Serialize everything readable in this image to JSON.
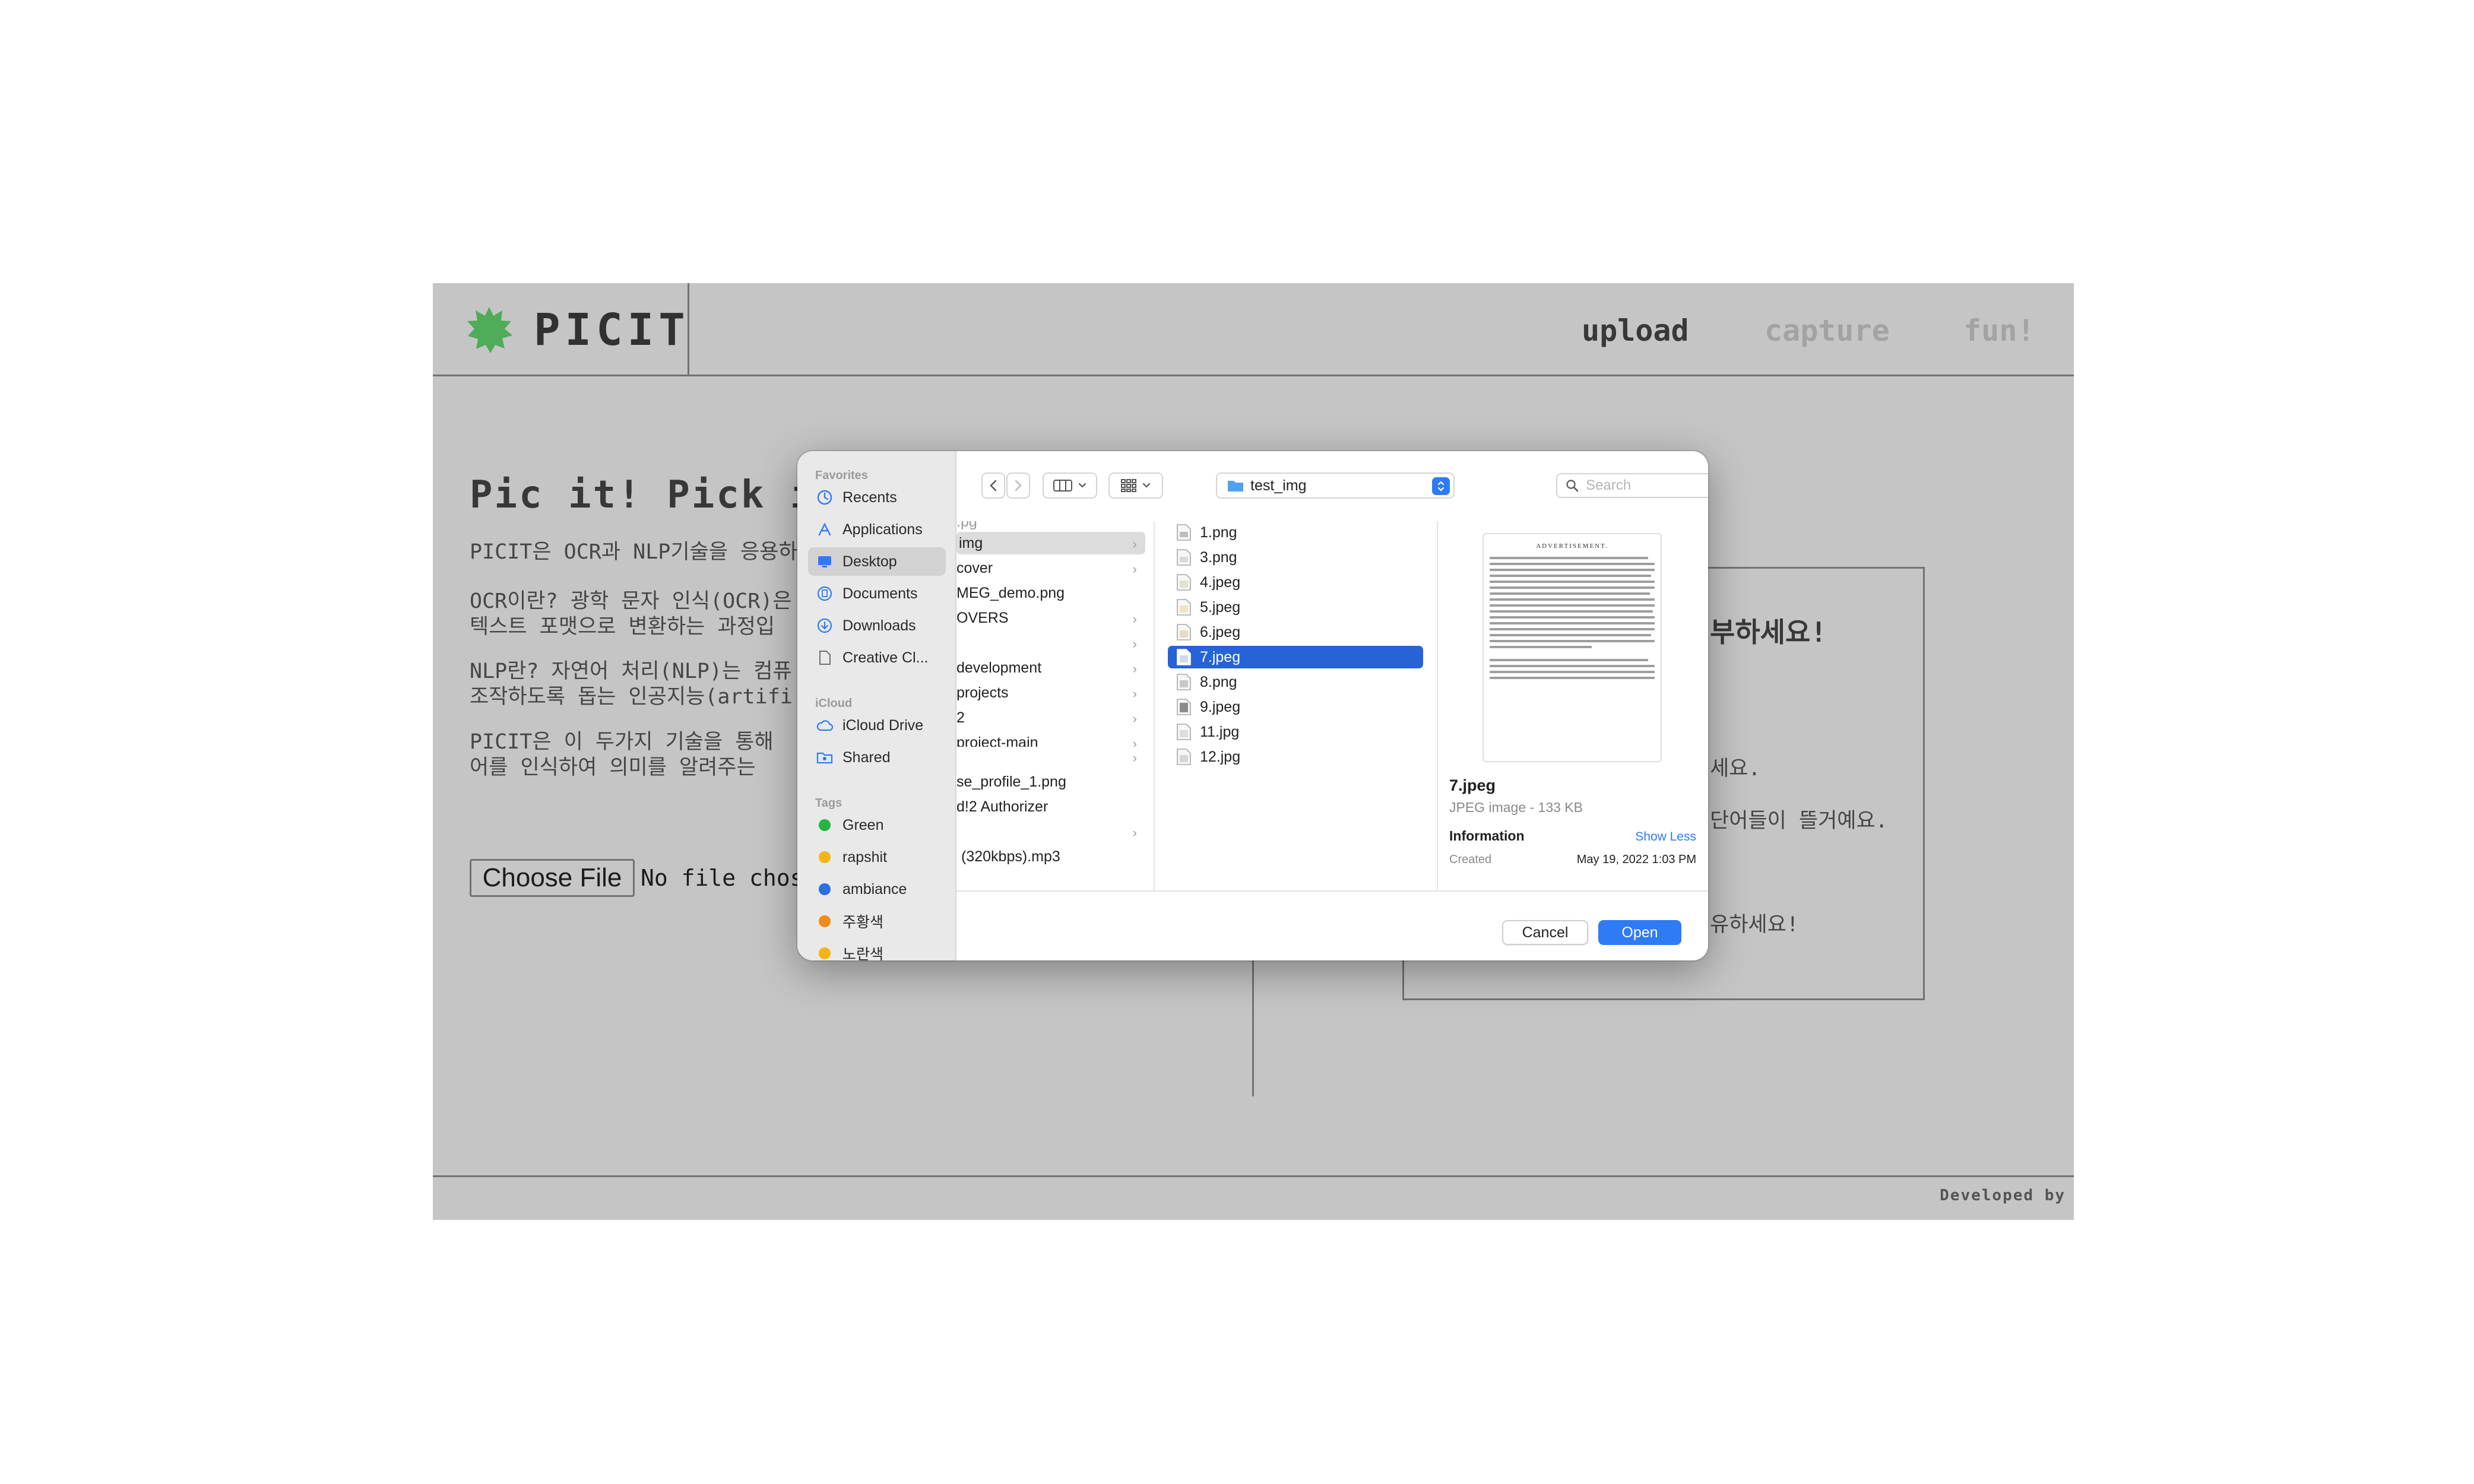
{
  "app": {
    "logo_text": "PICIT",
    "nav": {
      "upload": "upload",
      "capture": "capture",
      "fun": "fun!"
    },
    "hero_title": "Pic it! Pick it",
    "paragraphs": [
      "PICIT은 OCR과 NLP기술을 응용하",
      "OCR이란? 광학 문자 인식(OCR)은",
      "텍스트 포맷으로 변환하는 과정입",
      "NLP란? 자연어 처리(NLP)는 컴퓨",
      "조작하도록 돕는 인공지능(artifi",
      "PICIT은 이 두가지 기술을 통해",
      "어를 인식하여 의미를 알려주는"
    ],
    "file_input": {
      "button": "Choose File",
      "status": "No file chos"
    },
    "result_lines": [
      "부하세요!",
      "세요.",
      "단어들이 뜰거예요.",
      "유하세요!"
    ],
    "footer": "Developed by"
  },
  "dialog": {
    "sidebar": {
      "favorites_heading": "Favorites",
      "favorites": [
        {
          "label": "Recents",
          "icon": "clock-icon"
        },
        {
          "label": "Applications",
          "icon": "applications-icon"
        },
        {
          "label": "Desktop",
          "icon": "desktop-icon",
          "selected": true
        },
        {
          "label": "Documents",
          "icon": "document-icon"
        },
        {
          "label": "Downloads",
          "icon": "download-icon"
        },
        {
          "label": "Creative Cl...",
          "icon": "file-icon"
        }
      ],
      "icloud_heading": "iCloud",
      "icloud": [
        {
          "label": "iCloud Drive",
          "icon": "cloud-icon"
        },
        {
          "label": "Shared",
          "icon": "shared-folder-icon"
        }
      ],
      "tags_heading": "Tags",
      "tags": [
        {
          "label": "Green",
          "color": "#28b53c"
        },
        {
          "label": "rapshit",
          "color": "#f3b515"
        },
        {
          "label": "ambiance",
          "color": "#2b6fe0"
        },
        {
          "label": "주황색",
          "color": "#f08a1c"
        },
        {
          "label": "노란색",
          "color": "#f3b515"
        }
      ]
    },
    "path": "test_img",
    "search_placeholder": "Search",
    "column1": [
      {
        "label": "img",
        "folder": true,
        "selected": true
      },
      {
        "label": "cover",
        "folder": true
      },
      {
        "label": "MEG_demo.png",
        "folder": false
      },
      {
        "label": "OVERS",
        "folder": true
      },
      {
        "label": "",
        "folder": true
      },
      {
        "label": "development",
        "folder": true
      },
      {
        "label": "projects",
        "folder": true
      },
      {
        "label": "2",
        "folder": true
      },
      {
        "label": "project-main",
        "folder": true
      },
      {
        "label": "",
        "folder": true
      },
      {
        "label": "se_profile_1.png",
        "folder": false
      },
      {
        "label": "d!2 Authorizer",
        "folder": false
      },
      {
        "label": "",
        "folder": true
      },
      {
        "label": "(320kbps).mp3",
        "folder": false
      }
    ],
    "column2": [
      {
        "label": "1.png"
      },
      {
        "label": "3.png"
      },
      {
        "label": "4.jpeg"
      },
      {
        "label": "5.jpeg"
      },
      {
        "label": "6.jpeg"
      },
      {
        "label": "7.jpeg",
        "selected": true
      },
      {
        "label": "8.png"
      },
      {
        "label": "9.jpeg"
      },
      {
        "label": "11.jpg"
      },
      {
        "label": "12.jpg"
      }
    ],
    "preview": {
      "thumb_title": "ADVERTISEMENT.",
      "name": "7.jpeg",
      "meta": "JPEG image - 133 KB",
      "info_heading": "Information",
      "show_less": "Show Less",
      "created_label": "Created",
      "created_value": "May 19, 2022 1:03 PM"
    },
    "buttons": {
      "cancel": "Cancel",
      "open": "Open"
    },
    "colors": {
      "accent": "#2f7bf6",
      "selection": "#2563d7"
    }
  }
}
